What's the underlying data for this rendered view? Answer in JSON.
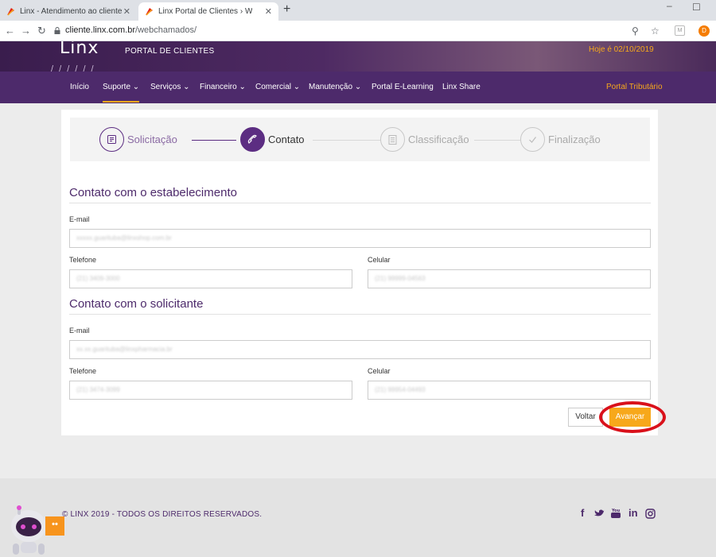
{
  "browser": {
    "tabs": [
      {
        "title": "Linx - Atendimento ao cliente",
        "active": false
      },
      {
        "title": "Linx Portal de Clientes › Webchamados",
        "active": true
      }
    ],
    "url_host": "cliente.linx.com.br",
    "url_path": "/webchamados/",
    "profile_initial": "D",
    "extension_label": "M"
  },
  "header": {
    "logo": "Linx",
    "portal_title": "PORTAL DE CLIENTES",
    "today": "Hoje é 02/10/2019"
  },
  "nav": {
    "items": [
      "Início",
      "Suporte ⌄",
      "Serviços ⌄",
      "Financeiro ⌄",
      "Comercial ⌄",
      "Manutenção ⌄",
      "Portal E-Learning",
      "Linx Share"
    ],
    "active_index": 1,
    "right_item": "Portal Tributário"
  },
  "steps": [
    {
      "label": "Solicitação",
      "state": "done",
      "icon": "document-icon"
    },
    {
      "label": "Contato",
      "state": "current",
      "icon": "phone-icon"
    },
    {
      "label": "Classificação",
      "state": "pending",
      "icon": "list-icon"
    },
    {
      "label": "Finalização",
      "state": "pending",
      "icon": "check-icon"
    }
  ],
  "establishment": {
    "title": "Contato com o estabelecimento",
    "email_label": "E-mail",
    "email_value": "xxxxx.guarituba@linxshop.com.br",
    "phone_label": "Telefone",
    "phone_value": "(21) 3409-3000",
    "mobile_label": "Celular",
    "mobile_value": "(21) 99999-04563"
  },
  "requester": {
    "title": "Contato com o solicitante",
    "email_label": "E-mail",
    "email_value": "xx.xx.guarituba@linxpharmacia.br",
    "phone_label": "Telefone",
    "phone_value": "(21) 3474-3099",
    "mobile_label": "Celular",
    "mobile_value": "(21) 99954-04493"
  },
  "actions": {
    "back": "Voltar",
    "next": "Avançar"
  },
  "footer": {
    "copyright": "© LINX 2019 - TODOS OS DIREITOS RESERVADOS.",
    "social_icons": [
      "facebook-icon",
      "twitter-icon",
      "youtube-icon",
      "linkedin-icon",
      "instagram-icon"
    ],
    "chat_label": "••"
  },
  "colors": {
    "brand_purple": "#4d2a6b",
    "accent_orange": "#f7a81b",
    "highlight_red": "#d9111b"
  }
}
